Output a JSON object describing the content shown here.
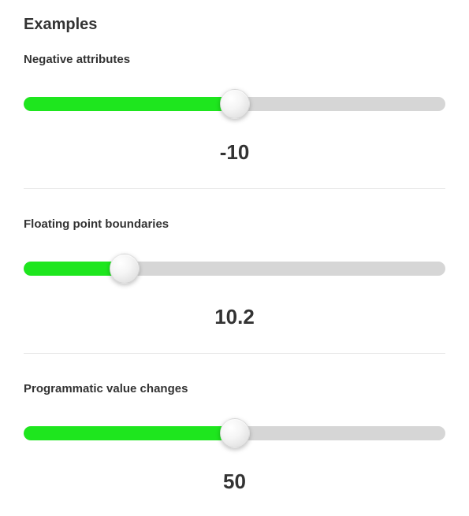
{
  "title": "Examples",
  "sliders": [
    {
      "label": "Negative attributes",
      "value": "-10",
      "fill_percent": 50,
      "handle_percent": 50
    },
    {
      "label": "Floating point boundaries",
      "value": "10.2",
      "fill_percent": 24,
      "handle_percent": 24
    },
    {
      "label": "Programmatic value changes",
      "value": "50",
      "fill_percent": 50,
      "handle_percent": 50
    }
  ]
}
